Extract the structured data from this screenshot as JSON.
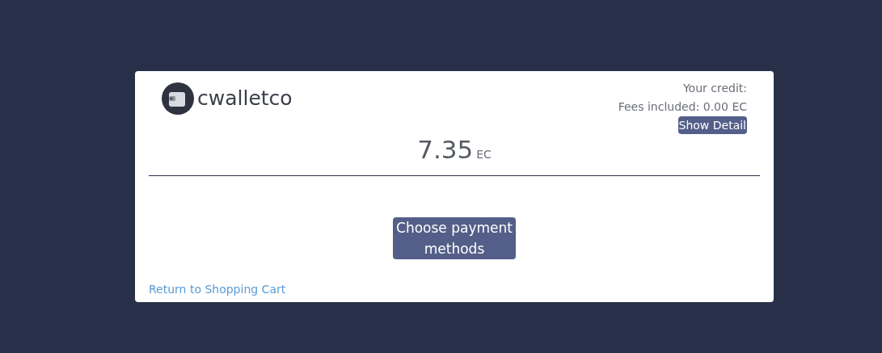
{
  "brand": {
    "name": "cwalletco"
  },
  "credit": {
    "label": "Your credit:",
    "fees": "Fees included: 0.00 EC",
    "detail_button": "Show Detail"
  },
  "amount": {
    "value": "7.35",
    "unit": "EC"
  },
  "pay_button": "Choose payment methods",
  "return_link": "Return to Shopping Cart"
}
